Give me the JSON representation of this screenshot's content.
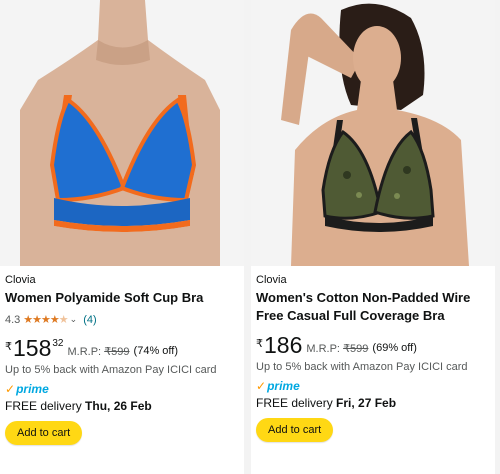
{
  "colors": {
    "price_text": "#0f1111",
    "muted_text": "#565959",
    "link": "#007185",
    "star": "#de7921",
    "prime_blue": "#00a8e1",
    "prime_orange": "#ff9900",
    "cart_button": "#ffd814"
  },
  "products": [
    {
      "brand": "Clovia",
      "title": "Women Polyamide Soft Cup Bra",
      "rating": "4.3",
      "rating_value": 4.3,
      "rating_max": 5,
      "review_count": "(4)",
      "price_currency": "₹",
      "price_whole": "158",
      "price_fraction": "32",
      "mrp_label": "M.R.P:",
      "mrp_value": "₹599",
      "discount": "(74% off)",
      "cashback": "Up to 5% back with Amazon Pay ICICI card",
      "prime_label": "prime",
      "delivery_prefix": "FREE delivery",
      "delivery_date": "Thu, 26 Feb",
      "cart_label": "Add to cart",
      "image_icon": "product-photo-blue-orange-bra"
    },
    {
      "brand": "Clovia",
      "title": "Women's Cotton Non-Padded Wire Free Casual Full Coverage Bra",
      "price_currency": "₹",
      "price_whole": "186",
      "mrp_label": "M.R.P:",
      "mrp_value": "₹599",
      "discount": "(69% off)",
      "cashback": "Up to 5% back with Amazon Pay ICICI card",
      "prime_label": "prime",
      "delivery_prefix": "FREE delivery",
      "delivery_date": "Fri, 27 Feb",
      "cart_label": "Add to cart",
      "image_icon": "product-photo-olive-paisley-bra"
    }
  ]
}
